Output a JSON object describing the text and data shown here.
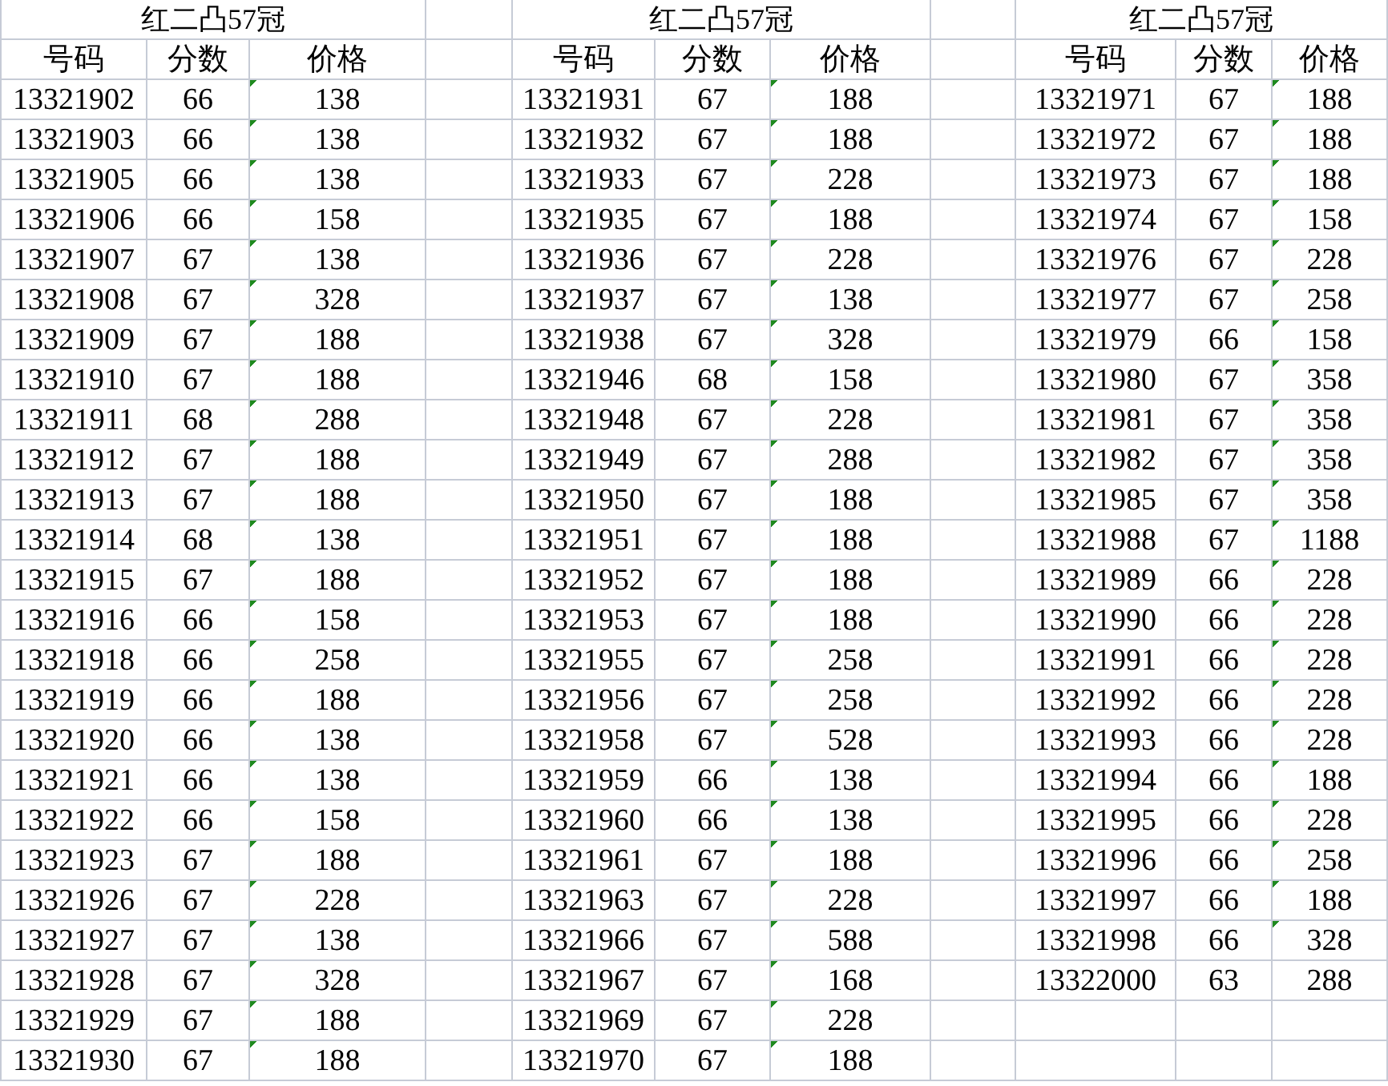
{
  "groups": [
    {
      "title": "红二凸57冠",
      "columns": [
        "号码",
        "分数",
        "价格"
      ],
      "rows": [
        {
          "code": "13321902",
          "score": "66",
          "price": "138",
          "text_flag": true
        },
        {
          "code": "13321903",
          "score": "66",
          "price": "138",
          "text_flag": true
        },
        {
          "code": "13321905",
          "score": "66",
          "price": "138",
          "text_flag": true
        },
        {
          "code": "13321906",
          "score": "66",
          "price": "158",
          "text_flag": true
        },
        {
          "code": "13321907",
          "score": "67",
          "price": "138",
          "text_flag": true
        },
        {
          "code": "13321908",
          "score": "67",
          "price": "328",
          "text_flag": true
        },
        {
          "code": "13321909",
          "score": "67",
          "price": "188",
          "text_flag": true
        },
        {
          "code": "13321910",
          "score": "67",
          "price": "188",
          "text_flag": true
        },
        {
          "code": "13321911",
          "score": "68",
          "price": "288",
          "text_flag": true
        },
        {
          "code": "13321912",
          "score": "67",
          "price": "188",
          "text_flag": true
        },
        {
          "code": "13321913",
          "score": "67",
          "price": "188",
          "text_flag": true
        },
        {
          "code": "13321914",
          "score": "68",
          "price": "138",
          "text_flag": true
        },
        {
          "code": "13321915",
          "score": "67",
          "price": "188",
          "text_flag": true
        },
        {
          "code": "13321916",
          "score": "66",
          "price": "158",
          "text_flag": true
        },
        {
          "code": "13321918",
          "score": "66",
          "price": "258",
          "text_flag": true
        },
        {
          "code": "13321919",
          "score": "66",
          "price": "188",
          "text_flag": true
        },
        {
          "code": "13321920",
          "score": "66",
          "price": "138",
          "text_flag": true
        },
        {
          "code": "13321921",
          "score": "66",
          "price": "138",
          "text_flag": true
        },
        {
          "code": "13321922",
          "score": "66",
          "price": "158",
          "text_flag": true
        },
        {
          "code": "13321923",
          "score": "67",
          "price": "188",
          "text_flag": true
        },
        {
          "code": "13321926",
          "score": "67",
          "price": "228",
          "text_flag": true
        },
        {
          "code": "13321927",
          "score": "67",
          "price": "138",
          "text_flag": true
        },
        {
          "code": "13321928",
          "score": "67",
          "price": "328",
          "text_flag": true
        },
        {
          "code": "13321929",
          "score": "67",
          "price": "188",
          "text_flag": true
        },
        {
          "code": "13321930",
          "score": "67",
          "price": "188",
          "text_flag": true
        }
      ]
    },
    {
      "title": "红二凸57冠",
      "columns": [
        "号码",
        "分数",
        "价格"
      ],
      "rows": [
        {
          "code": "13321931",
          "score": "67",
          "price": "188",
          "text_flag": true
        },
        {
          "code": "13321932",
          "score": "67",
          "price": "188",
          "text_flag": true
        },
        {
          "code": "13321933",
          "score": "67",
          "price": "228",
          "text_flag": true
        },
        {
          "code": "13321935",
          "score": "67",
          "price": "188",
          "text_flag": true
        },
        {
          "code": "13321936",
          "score": "67",
          "price": "228",
          "text_flag": true
        },
        {
          "code": "13321937",
          "score": "67",
          "price": "138",
          "text_flag": true
        },
        {
          "code": "13321938",
          "score": "67",
          "price": "328",
          "text_flag": true
        },
        {
          "code": "13321946",
          "score": "68",
          "price": "158",
          "text_flag": true
        },
        {
          "code": "13321948",
          "score": "67",
          "price": "228",
          "text_flag": true
        },
        {
          "code": "13321949",
          "score": "67",
          "price": "288",
          "text_flag": true
        },
        {
          "code": "13321950",
          "score": "67",
          "price": "188",
          "text_flag": true
        },
        {
          "code": "13321951",
          "score": "67",
          "price": "188",
          "text_flag": true
        },
        {
          "code": "13321952",
          "score": "67",
          "price": "188",
          "text_flag": true
        },
        {
          "code": "13321953",
          "score": "67",
          "price": "188",
          "text_flag": true
        },
        {
          "code": "13321955",
          "score": "67",
          "price": "258",
          "text_flag": true
        },
        {
          "code": "13321956",
          "score": "67",
          "price": "258",
          "text_flag": true
        },
        {
          "code": "13321958",
          "score": "67",
          "price": "528",
          "text_flag": true
        },
        {
          "code": "13321959",
          "score": "66",
          "price": "138",
          "text_flag": true
        },
        {
          "code": "13321960",
          "score": "66",
          "price": "138",
          "text_flag": true
        },
        {
          "code": "13321961",
          "score": "67",
          "price": "188",
          "text_flag": true
        },
        {
          "code": "13321963",
          "score": "67",
          "price": "228",
          "text_flag": true
        },
        {
          "code": "13321966",
          "score": "67",
          "price": "588",
          "text_flag": true
        },
        {
          "code": "13321967",
          "score": "67",
          "price": "168",
          "text_flag": true
        },
        {
          "code": "13321969",
          "score": "67",
          "price": "228",
          "text_flag": true
        },
        {
          "code": "13321970",
          "score": "67",
          "price": "188",
          "text_flag": true
        }
      ]
    },
    {
      "title": "红二凸57冠",
      "columns": [
        "号码",
        "分数",
        "价格"
      ],
      "rows": [
        {
          "code": "13321971",
          "score": "67",
          "price": "188",
          "text_flag": true
        },
        {
          "code": "13321972",
          "score": "67",
          "price": "188",
          "text_flag": true
        },
        {
          "code": "13321973",
          "score": "67",
          "price": "188",
          "text_flag": true
        },
        {
          "code": "13321974",
          "score": "67",
          "price": "158",
          "text_flag": true
        },
        {
          "code": "13321976",
          "score": "67",
          "price": "228",
          "text_flag": true
        },
        {
          "code": "13321977",
          "score": "67",
          "price": "258",
          "text_flag": true
        },
        {
          "code": "13321979",
          "score": "66",
          "price": "158",
          "text_flag": true
        },
        {
          "code": "13321980",
          "score": "67",
          "price": "358",
          "text_flag": true
        },
        {
          "code": "13321981",
          "score": "67",
          "price": "358",
          "text_flag": true
        },
        {
          "code": "13321982",
          "score": "67",
          "price": "358",
          "text_flag": true
        },
        {
          "code": "13321985",
          "score": "67",
          "price": "358",
          "text_flag": true
        },
        {
          "code": "13321988",
          "score": "67",
          "price": "1188",
          "text_flag": true
        },
        {
          "code": "13321989",
          "score": "66",
          "price": "228",
          "text_flag": true
        },
        {
          "code": "13321990",
          "score": "66",
          "price": "228",
          "text_flag": true
        },
        {
          "code": "13321991",
          "score": "66",
          "price": "228",
          "text_flag": true
        },
        {
          "code": "13321992",
          "score": "66",
          "price": "228",
          "text_flag": true
        },
        {
          "code": "13321993",
          "score": "66",
          "price": "228",
          "text_flag": true
        },
        {
          "code": "13321994",
          "score": "66",
          "price": "188",
          "text_flag": true
        },
        {
          "code": "13321995",
          "score": "66",
          "price": "228",
          "text_flag": true
        },
        {
          "code": "13321996",
          "score": "66",
          "price": "258",
          "text_flag": true
        },
        {
          "code": "13321997",
          "score": "66",
          "price": "188",
          "text_flag": true
        },
        {
          "code": "13321998",
          "score": "66",
          "price": "328",
          "text_flag": true
        },
        {
          "code": "13322000",
          "score": "63",
          "price": "288",
          "text_flag": false
        }
      ]
    }
  ]
}
